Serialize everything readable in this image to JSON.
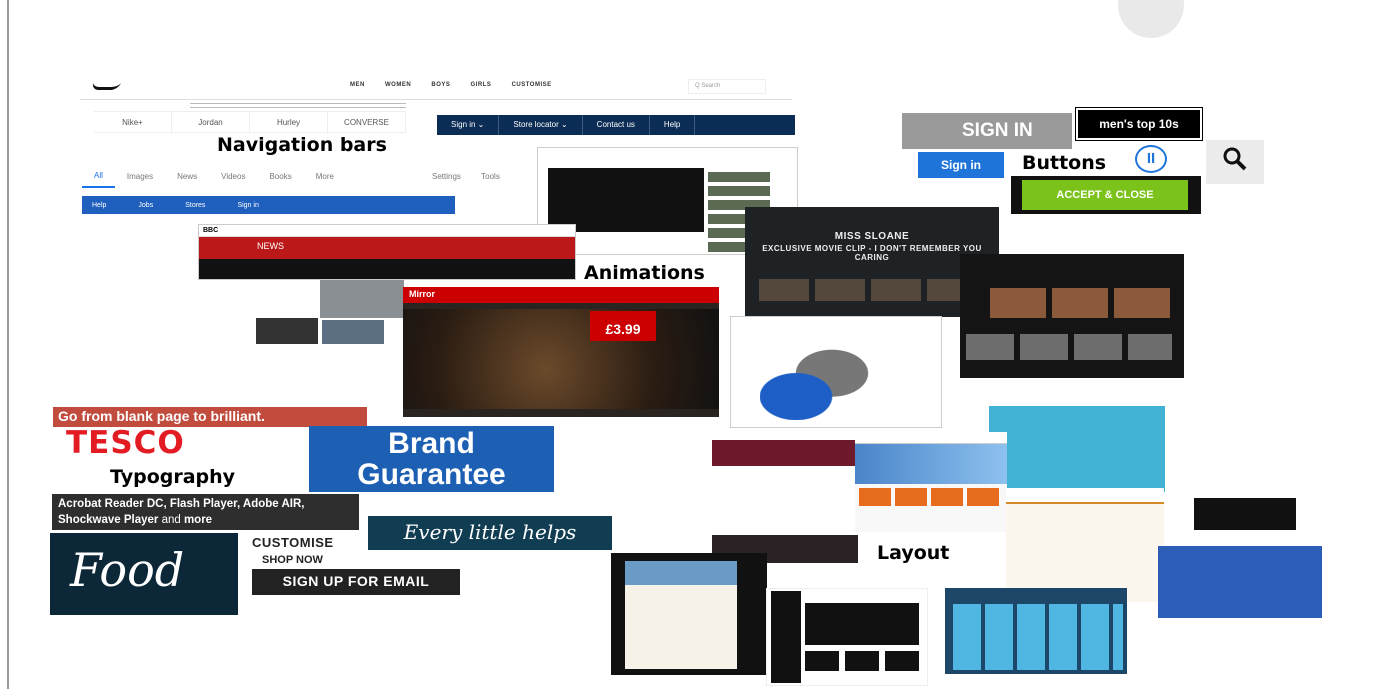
{
  "labels": {
    "navigation_bars": "Navigation bars",
    "buttons": "Buttons",
    "animations": "Animations",
    "typography": "Typography",
    "layout": "Layout"
  },
  "nav": {
    "nike_menu": [
      "MEN",
      "WOMEN",
      "BOYS",
      "GIRLS",
      "CUSTOMISE"
    ],
    "nike_search_placeholder": "Q Search",
    "brands": [
      "Nike+",
      "Jordan",
      "Hurley",
      "CONVERSE"
    ],
    "store_bar": [
      "Sign in ⌄",
      "Store locator ⌄",
      "Contact us",
      "Help"
    ],
    "google_tabs": [
      "All",
      "Images",
      "News",
      "Videos",
      "Books",
      "More"
    ],
    "google_right": [
      "Settings",
      "Tools"
    ],
    "help_bar": [
      "Help",
      "Jobs",
      "Stores",
      "Sign in"
    ]
  },
  "buttons": {
    "sign_in_grey": "SIGN IN",
    "mens_top": "men's top 10s",
    "sign_in_blue": "Sign in",
    "pause_icon": "pause-icon",
    "search_icon": "search-icon",
    "accept_close": "ACCEPT & CLOSE"
  },
  "animations": {
    "bbc_logo": "BBC",
    "bbc_section": "NEWS",
    "mirror_logo": "Mirror",
    "mirror_price": "£3.99",
    "movie_title": "MISS SLOANE",
    "movie_subtitle": "EXCLUSIVE MOVIE CLIP - I DON'T REMEMBER YOU CARING"
  },
  "typography": {
    "blank_page": "Go from blank page to brilliant.",
    "tesco": "TESCO",
    "brand_guarantee_1": "Brand",
    "brand_guarantee_2": "Guarantee",
    "acrobat_line1": "Acrobat Reader DC, Flash Player, Adobe AIR,",
    "acrobat_line2_bold": "Shockwave Player",
    "acrobat_line2_light": " and ",
    "acrobat_line2_more": "more",
    "every_little": "Every little helps",
    "food": "Food",
    "customise": "CUSTOMISE",
    "shop_now": "SHOP NOW",
    "sign_up_email": "SIGN UP FOR EMAIL"
  },
  "colors": {
    "tesco_red": "#e31b23",
    "brand_blue": "#1c5fb3",
    "accept_green": "#7bc21b",
    "nav_navy": "#0b2c55"
  }
}
